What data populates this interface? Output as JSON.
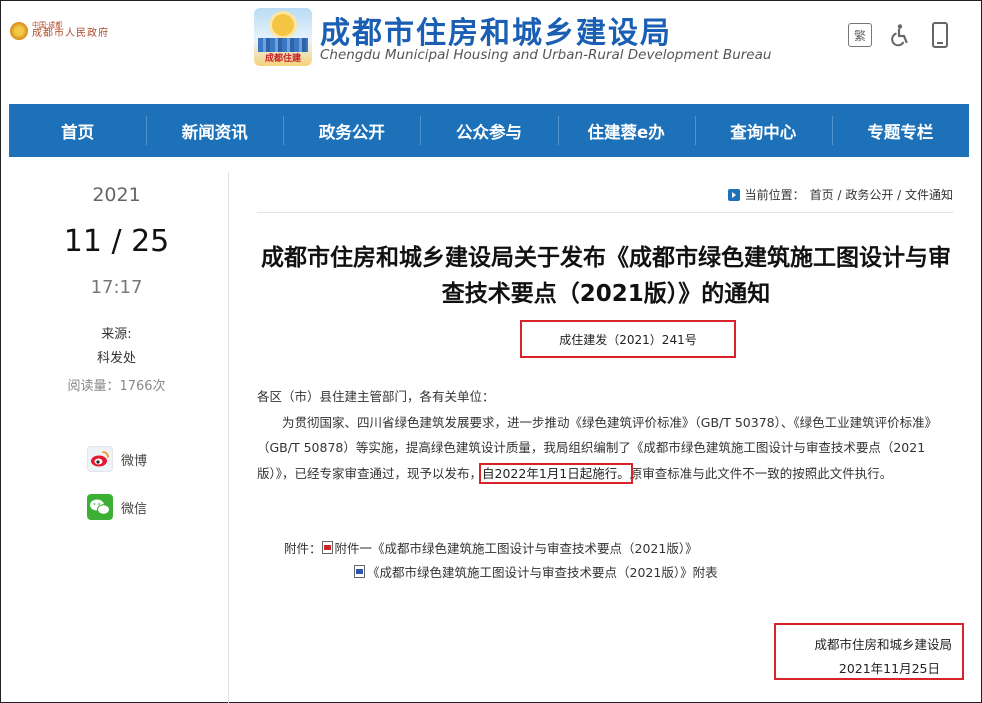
{
  "header": {
    "gov_logo_top": "中国·成都",
    "gov_logo_text": "成都市人民政府",
    "bureau_logo_caption": "成都住建",
    "title": "成都市住房和城乡建设局",
    "subtitle": "Chengdu Municipal Housing and Urban-Rural Development Bureau",
    "traditional_label": "繁",
    "tool_icons": [
      "traditional-chinese-toggle",
      "accessibility-icon",
      "mobile-icon"
    ]
  },
  "nav": {
    "items": [
      {
        "label": "首页"
      },
      {
        "label": "新闻资讯"
      },
      {
        "label": "政务公开"
      },
      {
        "label": "公众参与"
      },
      {
        "label": "住建蓉e办"
      },
      {
        "label": "查询中心"
      },
      {
        "label": "专题专栏"
      }
    ],
    "bg_color": "#1c71b9"
  },
  "sidebar": {
    "year": "2021",
    "month_day": "11 / 25",
    "time": "17:17",
    "source_label": "来源:",
    "source_value": "科发处",
    "read_count": "阅读量：1766次",
    "share_weibo": "微博",
    "share_wechat": "微信"
  },
  "breadcrumb": {
    "prefix": "当前位置：",
    "path": "首页 / 政务公开 / 文件通知"
  },
  "article": {
    "title": "成都市住房和城乡建设局关于发布《成都市绿色建筑施工图设计与审查技术要点（2021版）》的通知",
    "doc_number": "成住建发（2021）241号",
    "salutation": "各区（市）县住建主管部门，各有关单位：",
    "body_before": "为贯彻国家、四川省绿色建筑发展要求，进一步推动《绿色建筑评价标准》（GB/T 50378）、《绿色工业建筑评价标准》（GB/T 50878）等实施，提高绿色建筑设计质量，我局组织编制了《成都市绿色建筑施工图设计与审查技术要点（2021版）》，已经专家审查通过，现予以发布，",
    "body_highlight": "自2022年1月1日起施行。",
    "body_after": "原审查标准与此文件不一致的按照此文件执行。",
    "attachment_label": "附件：",
    "attachment_1": "附件一《成都市绿色建筑施工图设计与审查技术要点（2021版）》",
    "attachment_2": "《成都市绿色建筑施工图设计与审查技术要点（2021版）》附表",
    "signature_org": "成都市住房和城乡建设局",
    "signature_date": "2021年11月25日"
  },
  "colors": {
    "accent_blue": "#1c71b9",
    "highlight_red": "#d9232a"
  }
}
